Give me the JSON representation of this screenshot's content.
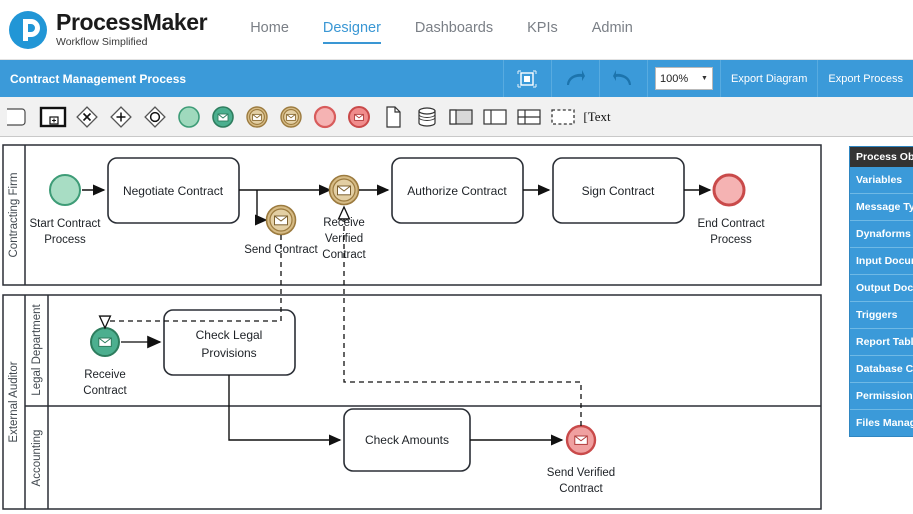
{
  "brand": {
    "title": "ProcessMaker",
    "tagline": "Workflow Simplified",
    "logo_icon": "processmaker-p-logo",
    "accent_color": "#3b9ad9"
  },
  "nav": {
    "items": [
      {
        "label": "Home",
        "active": false
      },
      {
        "label": "Designer",
        "active": true
      },
      {
        "label": "Dashboards",
        "active": false
      },
      {
        "label": "KPIs",
        "active": false
      },
      {
        "label": "Admin",
        "active": false
      }
    ]
  },
  "titlebar": {
    "process_title": "Contract Management Process",
    "fullscreen_icon": "fit-to-screen-icon",
    "redo_icon": "redo-arrow-icon",
    "undo_icon": "undo-arrow-icon",
    "zoom_value": "100%",
    "zoom_caret_icon": "chevron-down-icon",
    "export_diagram_label": "Export Diagram",
    "export_process_label": "Export Process"
  },
  "palette": {
    "items": [
      {
        "name": "task-tool",
        "icon": "rounded-rectangle-task-icon"
      },
      {
        "name": "subprocess-tool",
        "icon": "subprocess-plus-icon",
        "selected": true
      },
      {
        "name": "exclusive-gateway-tool",
        "icon": "exclusive-gateway-x-icon"
      },
      {
        "name": "parallel-gateway-tool",
        "icon": "parallel-gateway-plus-icon"
      },
      {
        "name": "inclusive-gateway-tool",
        "icon": "inclusive-gateway-circle-icon"
      },
      {
        "name": "start-event-tool",
        "icon": "start-event-green-circle-icon"
      },
      {
        "name": "start-message-event-tool",
        "icon": "start-message-event-green-icon"
      },
      {
        "name": "intermediate-catch-message-tool",
        "icon": "intermediate-message-catch-tan-icon"
      },
      {
        "name": "intermediate-throw-message-tool",
        "icon": "intermediate-message-throw-tan-icon"
      },
      {
        "name": "end-event-tool",
        "icon": "end-event-red-circle-icon"
      },
      {
        "name": "end-message-event-tool",
        "icon": "end-message-event-red-icon"
      },
      {
        "name": "data-object-tool",
        "icon": "data-object-page-icon"
      },
      {
        "name": "data-store-tool",
        "icon": "data-store-cylinder-icon"
      },
      {
        "name": "pool-tool",
        "icon": "pool-horizontal-icon"
      },
      {
        "name": "lane-vertical-tool",
        "icon": "lane-vertical-icon"
      },
      {
        "name": "lane-horizontal-tool",
        "icon": "lane-horizontal-icon"
      },
      {
        "name": "group-tool",
        "icon": "group-dashed-box-icon"
      },
      {
        "name": "text-annotation-tool",
        "icon": "text-annotation-icon",
        "label": "Text"
      }
    ]
  },
  "diagram": {
    "pools": [
      {
        "name": "contracting-firm-pool",
        "label": "Contracting Firm"
      },
      {
        "name": "external-auditor-pool",
        "label": "External Auditor"
      }
    ],
    "lanes": [
      {
        "name": "legal-department-lane",
        "label": "Legal Department"
      },
      {
        "name": "accounting-lane",
        "label": "Accounting"
      }
    ],
    "events": [
      {
        "name": "start-contract-process-event",
        "label": "Start Contract Process",
        "type": "start",
        "color": "#9fd9bd"
      },
      {
        "name": "send-contract-event",
        "label": "Send Contract",
        "type": "intermediate-message-throw",
        "color": "#d6bb85"
      },
      {
        "name": "receive-verified-contract-event",
        "label": "Receive Verified Contract",
        "type": "intermediate-message-catch",
        "color": "#d6bb85"
      },
      {
        "name": "end-contract-process-event",
        "label": "End Contract Process",
        "type": "end",
        "color": "#f5b3b3"
      },
      {
        "name": "receive-contract-event",
        "label": "Receive Contract",
        "type": "start-message",
        "color": "#4caf8f"
      },
      {
        "name": "send-verified-contract-event",
        "label": "Send Verified Contract",
        "type": "end-message",
        "color": "#f08c8c"
      }
    ],
    "tasks": [
      {
        "name": "negotiate-contract-task",
        "label": "Negotiate Contract"
      },
      {
        "name": "authorize-contract-task",
        "label": "Authorize Contract"
      },
      {
        "name": "sign-contract-task",
        "label": "Sign Contract"
      },
      {
        "name": "check-legal-provisions-task",
        "label": "Check Legal Provisions",
        "line1": "Check Legal",
        "line2": "Provisions"
      },
      {
        "name": "check-amounts-task",
        "label": "Check Amounts"
      }
    ]
  },
  "sidepanel": {
    "header": "Process Obj",
    "items": [
      {
        "label": "Variables",
        "name": "sidepanel-item-variables"
      },
      {
        "label": "Message Typ",
        "name": "sidepanel-item-message-types"
      },
      {
        "label": "Dynaforms",
        "name": "sidepanel-item-dynaforms"
      },
      {
        "label": "Input Docum",
        "name": "sidepanel-item-input-documents"
      },
      {
        "label": "Output Docu",
        "name": "sidepanel-item-output-documents"
      },
      {
        "label": "Triggers",
        "name": "sidepanel-item-triggers"
      },
      {
        "label": "Report Table",
        "name": "sidepanel-item-report-tables"
      },
      {
        "label": "Database Co",
        "name": "sidepanel-item-database-connections"
      },
      {
        "label": "Permissions",
        "name": "sidepanel-item-permissions"
      },
      {
        "label": "Files Manage",
        "name": "sidepanel-item-files-manager"
      }
    ]
  }
}
